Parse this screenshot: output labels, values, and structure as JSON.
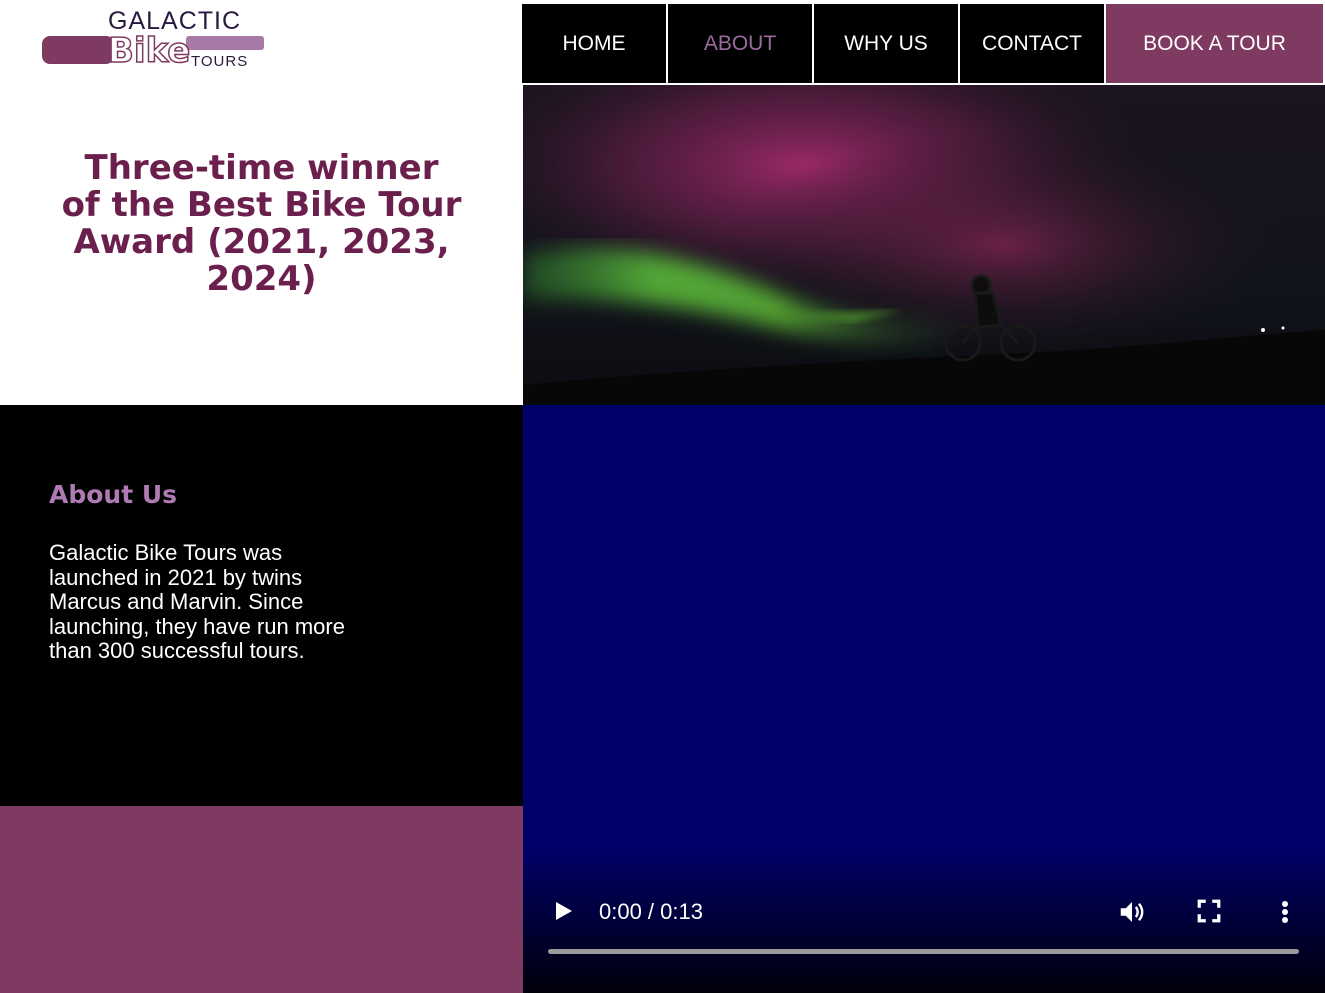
{
  "logo": {
    "line1": "GALACTIC",
    "line2": "Bike",
    "line3": "TOURS",
    "brand_color": "#7f3a62"
  },
  "nav": {
    "items": [
      {
        "label": "HOME",
        "active": false
      },
      {
        "label": "ABOUT",
        "active": true
      },
      {
        "label": "WHY US",
        "active": false
      },
      {
        "label": "CONTACT",
        "active": false
      }
    ],
    "cta_label": "BOOK A TOUR",
    "active_color": "#9b6b9e"
  },
  "hero": {
    "icon": "aurora-cyclist-photo"
  },
  "award": {
    "text": "Three-time winner of the Best Bike Tour Award (2021, 2023, 2024)"
  },
  "about": {
    "title": "About Us",
    "body": "Galactic Bike Tours was launched in 2021 by twins Marcus and Marvin.  Since launching, they have run more than 300 successful tours."
  },
  "video": {
    "time": "0:00 / 0:13",
    "progress": 0,
    "background": "#00006b"
  }
}
